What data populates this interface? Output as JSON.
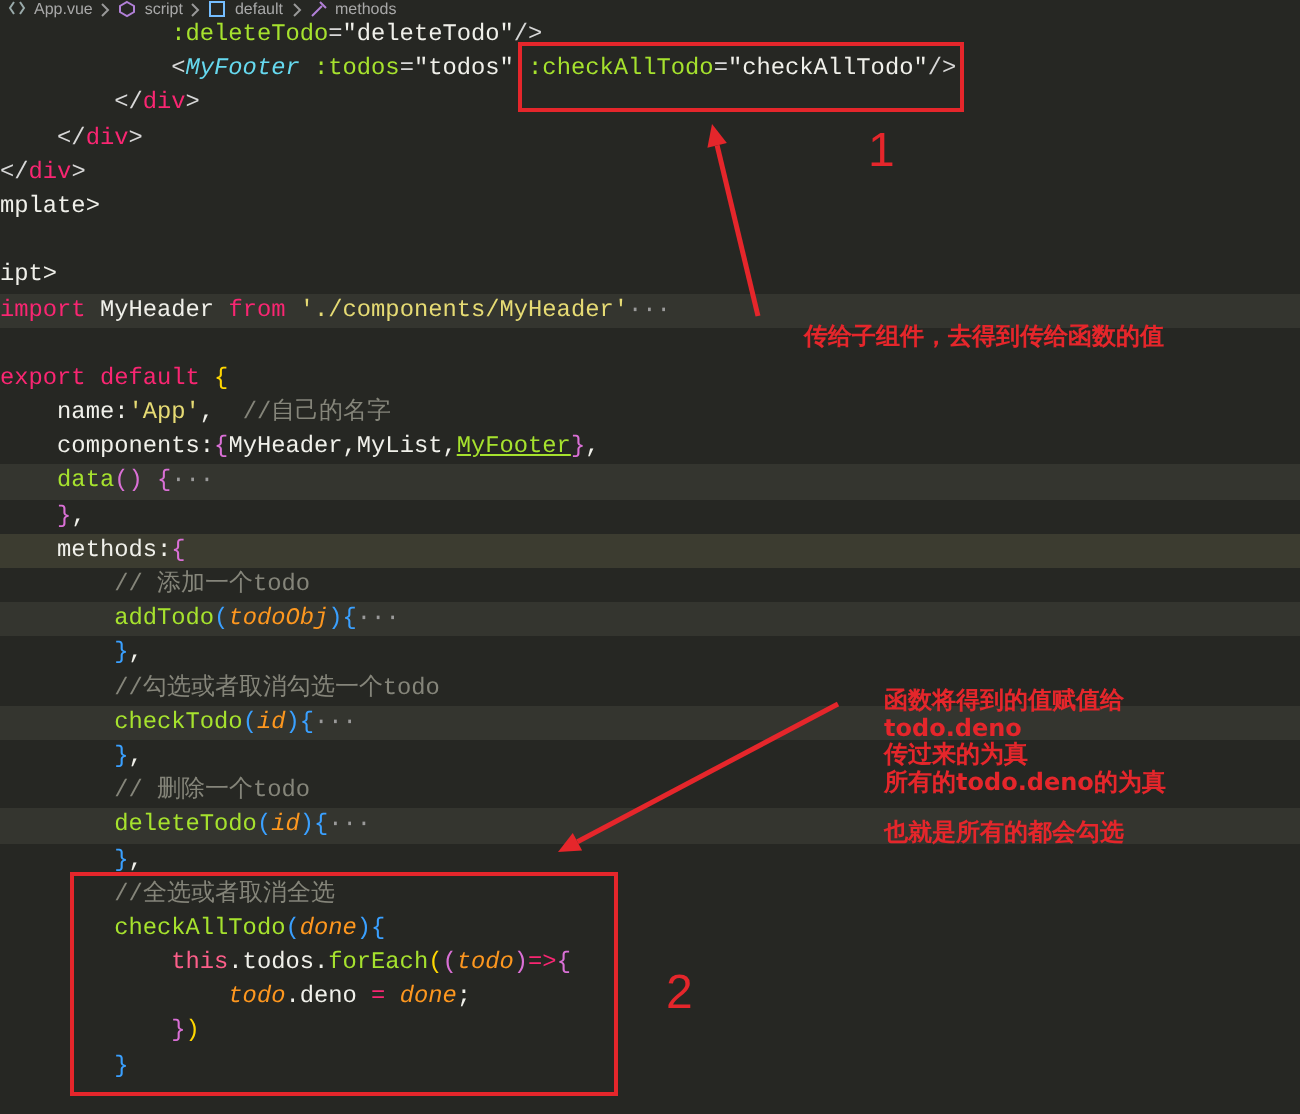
{
  "breadcrumb": [
    {
      "label": "App.vue",
      "kind": "file"
    },
    {
      "label": "script",
      "kind": "block"
    },
    {
      "label": "default",
      "kind": "module"
    },
    {
      "label": "methods",
      "kind": "method"
    }
  ],
  "code": {
    "lines": [
      {
        "folded": false,
        "current": false,
        "tokens": [
          {
            "t": "            :deleteTodo",
            "kind": "attr"
          },
          {
            "t": "=",
            "kind": "punct"
          },
          {
            "t": "\"deleteTodo\"",
            "kind": "string"
          },
          {
            "t": "/>",
            "kind": "punct"
          }
        ]
      },
      {
        "folded": false,
        "current": false,
        "tokens": [
          {
            "t": "            <",
            "kind": "punct"
          },
          {
            "t": "MyFooter",
            "kind": "component"
          },
          {
            "t": " :todos",
            "kind": "attr"
          },
          {
            "t": "=",
            "kind": "punct"
          },
          {
            "t": "\"todos\"",
            "kind": "string"
          },
          {
            "t": " :checkAllTodo",
            "kind": "attr"
          },
          {
            "t": "=",
            "kind": "punct"
          },
          {
            "t": "\"checkAllTodo\"",
            "kind": "string"
          },
          {
            "t": "/>",
            "kind": "punct"
          }
        ]
      },
      {
        "folded": false,
        "current": false,
        "tokens": [
          {
            "t": "        </",
            "kind": "punct"
          },
          {
            "t": "div",
            "kind": "tag"
          },
          {
            "t": ">",
            "kind": "punct"
          }
        ]
      },
      {
        "folded": false,
        "current": false,
        "tokens": [
          {
            "t": "    </",
            "kind": "punct"
          },
          {
            "t": "div",
            "kind": "tag"
          },
          {
            "t": ">",
            "kind": "punct"
          }
        ]
      },
      {
        "folded": false,
        "current": false,
        "tokens": [
          {
            "t": "</",
            "kind": "punct"
          },
          {
            "t": "div",
            "kind": "tag"
          },
          {
            "t": ">",
            "kind": "punct"
          }
        ]
      },
      {
        "folded": false,
        "current": false,
        "tokens": [
          {
            "t": "mplate>",
            "kind": "plain"
          }
        ]
      },
      {
        "folded": false,
        "current": false
      },
      {
        "folded": false,
        "current": false,
        "tokens": [
          {
            "t": "ipt>",
            "kind": "plain"
          }
        ]
      },
      {
        "folded": true,
        "current": false,
        "tokens": [
          {
            "t": "import",
            "kind": "keyword"
          },
          {
            "t": " MyHeader ",
            "kind": "plain"
          },
          {
            "t": "from",
            "kind": "keyword"
          },
          {
            "t": " './components/MyHeader'",
            "kind": "string2"
          },
          {
            "t": "···",
            "kind": "fold"
          }
        ]
      },
      {
        "folded": false,
        "current": false
      },
      {
        "folded": false,
        "current": false,
        "tokens": [
          {
            "t": "export default",
            "kind": "keyword"
          },
          {
            "t": " {",
            "kind": "b1"
          }
        ]
      },
      {
        "folded": false,
        "current": false,
        "tokens": [
          {
            "t": "    name:",
            "kind": "plain"
          },
          {
            "t": "'App'",
            "kind": "string2"
          },
          {
            "t": ",",
            "kind": "plain"
          },
          {
            "t": "  //自己的名字",
            "kind": "comment"
          }
        ]
      },
      {
        "folded": false,
        "current": false,
        "tokens": [
          {
            "t": "    components:",
            "kind": "plain"
          },
          {
            "t": "{",
            "kind": "b2"
          },
          {
            "t": "MyHeader,MyList,",
            "kind": "plain"
          },
          {
            "t": "MyFooter",
            "kind": "match"
          },
          {
            "t": "}",
            "kind": "b2"
          },
          {
            "t": ",",
            "kind": "plain"
          }
        ]
      },
      {
        "folded": true,
        "current": false,
        "tokens": [
          {
            "t": "    data",
            "kind": "func"
          },
          {
            "t": "()",
            "kind": "b2"
          },
          {
            "t": " {",
            "kind": "b2"
          },
          {
            "t": "···",
            "kind": "fold"
          }
        ]
      },
      {
        "folded": false,
        "current": false,
        "tokens": [
          {
            "t": "    }",
            "kind": "b2"
          },
          {
            "t": ",",
            "kind": "plain"
          }
        ]
      },
      {
        "folded": false,
        "current": true,
        "tokens": [
          {
            "t": "    methods:",
            "kind": "plain"
          },
          {
            "t": "{",
            "kind": "b2"
          }
        ]
      },
      {
        "folded": false,
        "current": false,
        "tokens": [
          {
            "t": "        // 添加一个todo",
            "kind": "comment"
          }
        ]
      },
      {
        "folded": true,
        "current": false,
        "tokens": [
          {
            "t": "        addTodo",
            "kind": "func"
          },
          {
            "t": "(",
            "kind": "b3"
          },
          {
            "t": "todoObj",
            "kind": "param"
          },
          {
            "t": ")",
            "kind": "b3"
          },
          {
            "t": "{",
            "kind": "b3"
          },
          {
            "t": "···",
            "kind": "fold"
          }
        ]
      },
      {
        "folded": false,
        "current": false,
        "tokens": [
          {
            "t": "        }",
            "kind": "b3"
          },
          {
            "t": ",",
            "kind": "plain"
          }
        ]
      },
      {
        "folded": false,
        "current": false,
        "tokens": [
          {
            "t": "        //勾选或者取消勾选一个todo",
            "kind": "comment"
          }
        ]
      },
      {
        "folded": true,
        "current": false,
        "tokens": [
          {
            "t": "        checkTodo",
            "kind": "func"
          },
          {
            "t": "(",
            "kind": "b3"
          },
          {
            "t": "id",
            "kind": "param"
          },
          {
            "t": ")",
            "kind": "b3"
          },
          {
            "t": "{",
            "kind": "b3"
          },
          {
            "t": "···",
            "kind": "fold"
          }
        ]
      },
      {
        "folded": false,
        "current": false,
        "tokens": [
          {
            "t": "        }",
            "kind": "b3"
          },
          {
            "t": ",",
            "kind": "plain"
          }
        ]
      },
      {
        "folded": false,
        "current": false,
        "tokens": [
          {
            "t": "        // 删除一个todo",
            "kind": "comment"
          }
        ]
      },
      {
        "folded": true,
        "current": false,
        "tokens": [
          {
            "t": "        deleteTodo",
            "kind": "func"
          },
          {
            "t": "(",
            "kind": "b3"
          },
          {
            "t": "id",
            "kind": "param"
          },
          {
            "t": ")",
            "kind": "b3"
          },
          {
            "t": "{",
            "kind": "b3"
          },
          {
            "t": "···",
            "kind": "fold"
          }
        ]
      },
      {
        "folded": false,
        "current": false,
        "tokens": [
          {
            "t": "        }",
            "kind": "b3"
          },
          {
            "t": ",",
            "kind": "plain"
          }
        ]
      },
      {
        "folded": false,
        "current": false,
        "tokens": [
          {
            "t": "        //全选或者取消全选",
            "kind": "comment"
          }
        ]
      },
      {
        "folded": false,
        "current": false,
        "tokens": [
          {
            "t": "        checkAllTodo",
            "kind": "func"
          },
          {
            "t": "(",
            "kind": "b3"
          },
          {
            "t": "done",
            "kind": "param"
          },
          {
            "t": ")",
            "kind": "b3"
          },
          {
            "t": "{",
            "kind": "b3"
          }
        ]
      },
      {
        "folded": false,
        "current": false,
        "tokens": [
          {
            "t": "            this",
            "kind": "this"
          },
          {
            "t": ".todos.",
            "kind": "plain"
          },
          {
            "t": "forEach",
            "kind": "func"
          },
          {
            "t": "(",
            "kind": "b1"
          },
          {
            "t": "(",
            "kind": "b2"
          },
          {
            "t": "todo",
            "kind": "param"
          },
          {
            "t": ")",
            "kind": "b2"
          },
          {
            "t": "=>",
            "kind": "keyword"
          },
          {
            "t": "{",
            "kind": "b2"
          }
        ]
      },
      {
        "folded": false,
        "current": false,
        "tokens": [
          {
            "t": "                todo",
            "kind": "param"
          },
          {
            "t": ".deno ",
            "kind": "plain"
          },
          {
            "t": "=",
            "kind": "keyword"
          },
          {
            "t": " done",
            "kind": "param"
          },
          {
            "t": ";",
            "kind": "plain"
          }
        ]
      },
      {
        "folded": false,
        "current": false,
        "tokens": [
          {
            "t": "            }",
            "kind": "b2"
          },
          {
            "t": ")",
            "kind": "b1"
          }
        ]
      },
      {
        "folded": false,
        "current": false,
        "tokens": [
          {
            "t": "        }",
            "kind": "b3"
          }
        ]
      }
    ]
  },
  "annotations": {
    "boxes": [
      {
        "label": "1"
      },
      {
        "label": "2"
      }
    ],
    "notes": [
      {
        "lines": [
          "传给子组件，去得到传给函数的值"
        ]
      },
      {
        "lines": [
          "函数将得到的值赋值给",
          "todo.deno",
          "传过来的为真",
          "所有的todo.deno的为真"
        ]
      },
      {
        "lines": [
          "也就是所有的都会勾选"
        ]
      }
    ]
  }
}
